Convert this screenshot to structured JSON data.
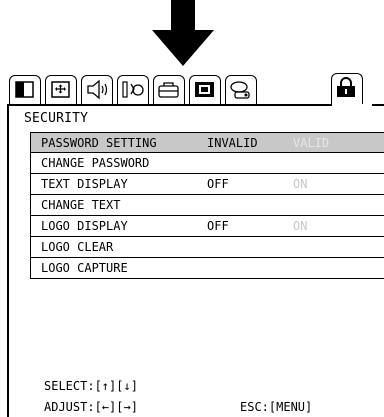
{
  "menu": {
    "title": "SECURITY",
    "tabs": [
      {
        "icon": "picture-icon"
      },
      {
        "icon": "image-adjust-icon"
      },
      {
        "icon": "speaker-icon"
      },
      {
        "icon": "input-icon"
      },
      {
        "icon": "setup-icon"
      },
      {
        "icon": "screen-icon"
      },
      {
        "icon": "option-icon"
      },
      {
        "icon": "lock-icon",
        "active": true
      }
    ],
    "items": [
      {
        "label": "PASSWORD SETTING",
        "value1": "INVALID",
        "value2": "VALID",
        "selected": true
      },
      {
        "label": "CHANGE PASSWORD",
        "value1": "",
        "value2": ""
      },
      {
        "label": "TEXT DISPLAY",
        "value1": "OFF",
        "value2": "ON"
      },
      {
        "label": "CHANGE TEXT",
        "value1": "",
        "value2": ""
      },
      {
        "label": "LOGO DISPLAY",
        "value1": "OFF",
        "value2": "ON"
      },
      {
        "label": "LOGO CLEAR",
        "value1": "",
        "value2": ""
      },
      {
        "label": "LOGO CAPTURE",
        "value1": "",
        "value2": ""
      }
    ],
    "footer": {
      "select": "SELECT:[↑][↓]",
      "adjust": "ADJUST:[←][→]",
      "esc": "ESC:[MENU]"
    }
  }
}
